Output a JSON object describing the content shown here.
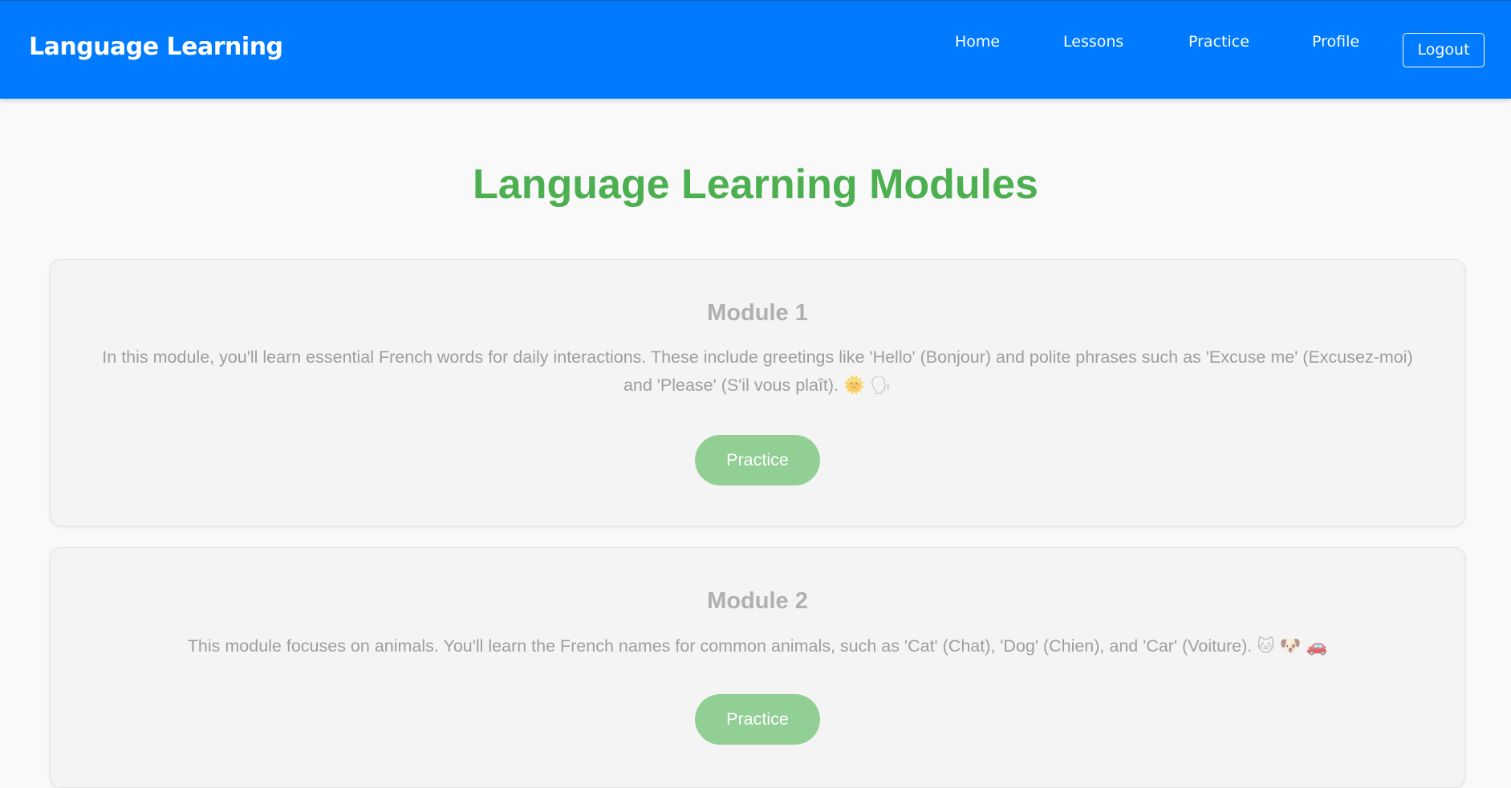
{
  "navbar": {
    "brand": "Language Learning",
    "links": [
      "Home",
      "Lessons",
      "Practice",
      "Profile"
    ],
    "logout_label": "Logout"
  },
  "main": {
    "title": "Language Learning Modules",
    "modules": [
      {
        "title": "Module 1",
        "description": "In this module, you'll learn essential French words for daily interactions. These include greetings like 'Hello' (Bonjour) and polite phrases such as 'Excuse me' (Excusez-moi) and 'Please' (S'il vous plaît).",
        "emojis": [
          "🌞",
          "🗣"
        ],
        "button_label": "Practice"
      },
      {
        "title": "Module 2",
        "description": "This module focuses on animals. You'll learn the French names for common animals, such as 'Cat' (Chat), 'Dog' (Chien), and 'Car' (Voiture).",
        "emojis": [
          "🐱",
          "🐶",
          "🚗"
        ],
        "button_label": "Practice"
      }
    ]
  },
  "colors": {
    "navbar_bg": "#007bff",
    "title_green": "#4caf50",
    "button_green": "#92cf94",
    "page_bg": "#f9f9f9"
  }
}
